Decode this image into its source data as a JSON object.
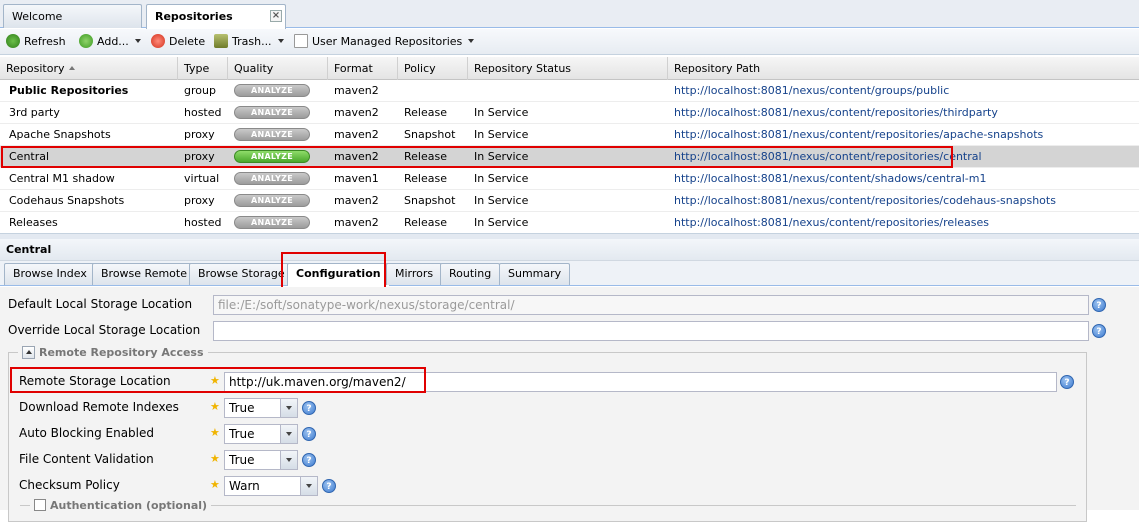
{
  "tabs": [
    {
      "label": "Welcome",
      "active": false
    },
    {
      "label": "Repositories",
      "active": true
    }
  ],
  "toolbar": {
    "refresh": "Refresh",
    "add": "Add...",
    "delete": "Delete",
    "trash": "Trash...",
    "user_managed": "User Managed Repositories"
  },
  "grid": {
    "columns": [
      "Repository",
      "Type",
      "Quality",
      "Format",
      "Policy",
      "Repository Status",
      "Repository Path"
    ],
    "analyze_label": "ANALYZE",
    "rows": [
      {
        "name": "Public Repositories",
        "type": "group",
        "format": "maven2",
        "policy": "",
        "status": "",
        "path": "http://localhost:8081/nexus/content/groups/public",
        "bold": true
      },
      {
        "name": "3rd party",
        "type": "hosted",
        "format": "maven2",
        "policy": "Release",
        "status": "In Service",
        "path": "http://localhost:8081/nexus/content/repositories/thirdparty"
      },
      {
        "name": "Apache Snapshots",
        "type": "proxy",
        "format": "maven2",
        "policy": "Snapshot",
        "status": "In Service",
        "path": "http://localhost:8081/nexus/content/repositories/apache-snapshots"
      },
      {
        "name": "Central",
        "type": "proxy",
        "format": "maven2",
        "policy": "Release",
        "status": "In Service",
        "path": "http://localhost:8081/nexus/content/repositories/central",
        "selected": true
      },
      {
        "name": "Central M1 shadow",
        "type": "virtual",
        "format": "maven1",
        "policy": "Release",
        "status": "In Service",
        "path": "http://localhost:8081/nexus/content/shadows/central-m1"
      },
      {
        "name": "Codehaus Snapshots",
        "type": "proxy",
        "format": "maven2",
        "policy": "Snapshot",
        "status": "In Service",
        "path": "http://localhost:8081/nexus/content/repositories/codehaus-snapshots"
      },
      {
        "name": "Releases",
        "type": "hosted",
        "format": "maven2",
        "policy": "Release",
        "status": "In Service",
        "path": "http://localhost:8081/nexus/content/repositories/releases"
      }
    ]
  },
  "detail": {
    "title": "Central",
    "tabs": [
      "Browse Index",
      "Browse Remote",
      "Browse Storage",
      "Configuration",
      "Mirrors",
      "Routing",
      "Summary"
    ],
    "active_tab": "Configuration"
  },
  "form": {
    "default_local_label": "Default Local Storage Location",
    "default_local_value": "file:/E:/soft/sonatype-work/nexus/storage/central/",
    "override_local_label": "Override Local Storage Location",
    "override_local_value": "",
    "remote_section": "Remote Repository Access",
    "remote_storage_label": "Remote Storage Location",
    "remote_storage_value": "http://uk.maven.org/maven2/",
    "download_indexes_label": "Download Remote Indexes",
    "download_indexes_value": "True",
    "auto_blocking_label": "Auto Blocking Enabled",
    "auto_blocking_value": "True",
    "file_validation_label": "File Content Validation",
    "file_validation_value": "True",
    "checksum_label": "Checksum Policy",
    "checksum_value": "Warn",
    "auth_section": "Authentication (optional)"
  },
  "colors": {
    "highlight": "#e00000",
    "link": "#15428b",
    "analyze_active": "#4aa82c",
    "selected_row": "#d4d4d4"
  }
}
